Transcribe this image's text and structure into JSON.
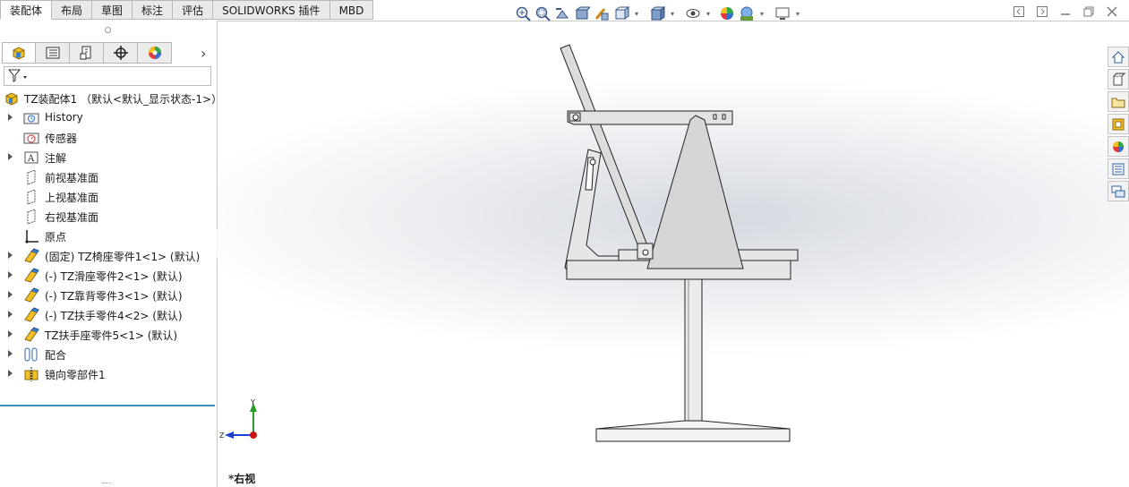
{
  "tabs": [
    {
      "label": "装配体",
      "active": true
    },
    {
      "label": "布局",
      "active": false
    },
    {
      "label": "草图",
      "active": false
    },
    {
      "label": "标注",
      "active": false
    },
    {
      "label": "评估",
      "active": false
    },
    {
      "label": "SOLIDWORKS 插件",
      "active": false
    },
    {
      "label": "MBD",
      "active": false
    }
  ],
  "tree": {
    "root": "TZ装配体1 （默认<默认_显示状态-1>）",
    "items": [
      {
        "label": "History",
        "icon": "history-folder-icon",
        "expandable": true
      },
      {
        "label": "传感器",
        "icon": "sensor-icon",
        "expandable": false
      },
      {
        "label": "注解",
        "icon": "annotation-icon",
        "expandable": true
      },
      {
        "label": "前视基准面",
        "icon": "plane-icon",
        "expandable": false
      },
      {
        "label": "上视基准面",
        "icon": "plane-icon",
        "expandable": false
      },
      {
        "label": "右视基准面",
        "icon": "plane-icon",
        "expandable": false
      },
      {
        "label": "原点",
        "icon": "origin-icon",
        "expandable": false
      },
      {
        "label": "(固定) TZ椅座零件1<1> (默认)",
        "icon": "part-icon",
        "expandable": true
      },
      {
        "label": "(-) TZ滑座零件2<1> (默认)",
        "icon": "part-icon",
        "expandable": true
      },
      {
        "label": "(-) TZ靠背零件3<1> (默认)",
        "icon": "part-icon",
        "expandable": true
      },
      {
        "label": "(-) TZ扶手零件4<2> (默认)",
        "icon": "part-icon",
        "expandable": true
      },
      {
        "label": "TZ扶手座零件5<1> (默认)",
        "icon": "part-icon",
        "expandable": true
      },
      {
        "label": "配合",
        "icon": "mates-icon",
        "expandable": true
      },
      {
        "label": "镜向零部件1",
        "icon": "mirror-component-icon",
        "expandable": true
      }
    ]
  },
  "triad": {
    "y_label": "Y",
    "z_label": "Z"
  },
  "view_label": "*右视",
  "colors": {
    "accent": "#3b8fc0",
    "triad_y": "#2a9a2a",
    "triad_z": "#1f3fd0",
    "triad_x": "#cc1111"
  }
}
